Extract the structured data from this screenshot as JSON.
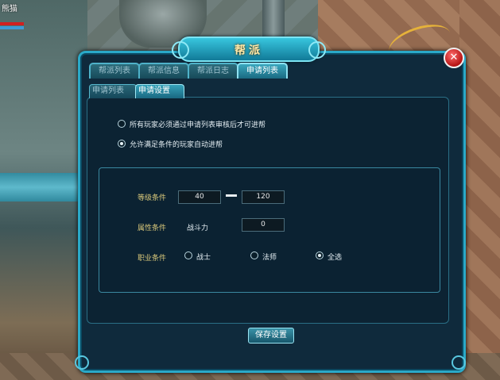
{
  "hud": {
    "player_name": "熊猫"
  },
  "window": {
    "title": "帮派",
    "close_symbol": "✕"
  },
  "tabs": [
    {
      "label": "帮派列表",
      "active": false
    },
    {
      "label": "帮派信息",
      "active": false
    },
    {
      "label": "帮派日志",
      "active": false
    },
    {
      "label": "申请列表",
      "active": true
    }
  ],
  "subtabs": [
    {
      "label": "申请列表",
      "active": false
    },
    {
      "label": "申请设置",
      "active": true
    }
  ],
  "join_mode": {
    "options": [
      {
        "label": "所有玩家必须通过申请列表审核后才可进帮",
        "selected": false
      },
      {
        "label": "允许满足条件的玩家自动进帮",
        "selected": true
      }
    ]
  },
  "conditions": {
    "level_label": "等级条件",
    "level_min": "40",
    "level_max": "120",
    "attribute_label": "属性条件",
    "attribute_name": "战斗力",
    "attribute_value": "0",
    "class_label": "职业条件",
    "class_options": [
      {
        "label": "战士",
        "selected": false
      },
      {
        "label": "法师",
        "selected": false
      },
      {
        "label": "全选",
        "selected": true
      }
    ]
  },
  "save_label": "保存设置",
  "colors": {
    "frame": "#2aa9c8",
    "panel": "#0f2a3c",
    "title_text": "#ffe9a8",
    "condition_label": "#d8c77a"
  }
}
